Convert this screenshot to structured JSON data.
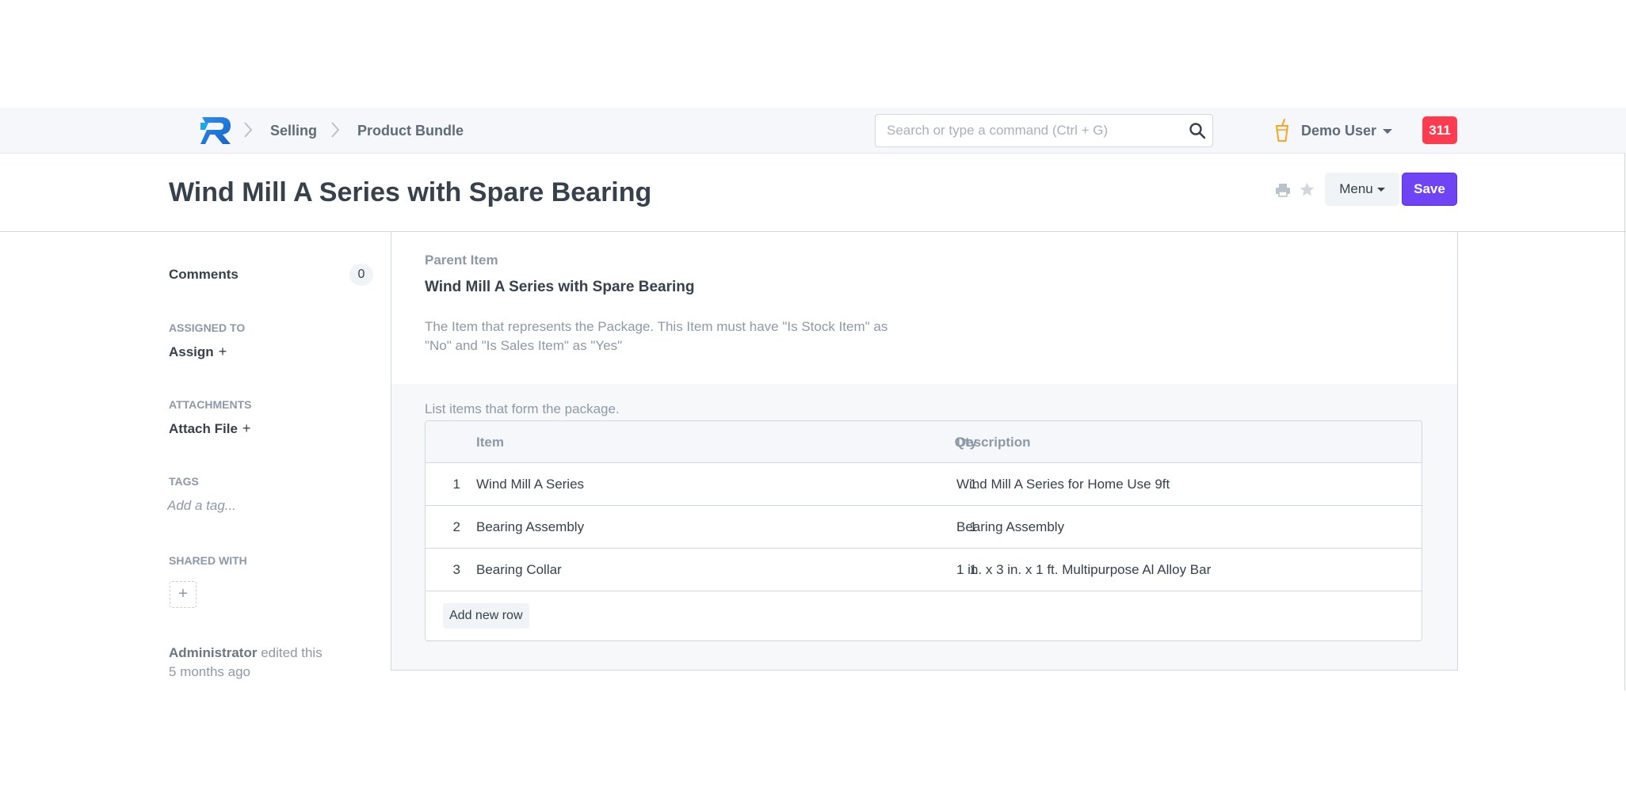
{
  "navbar": {
    "breadcrumbs": [
      "Selling",
      "Product Bundle"
    ],
    "search_placeholder": "Search or type a command (Ctrl + G)",
    "user_name": "Demo User",
    "notification_count": "311",
    "brand_color": "#2490ef",
    "badge_color": "#ff3b4f"
  },
  "page": {
    "title": "Wind Mill A Series with Spare Bearing",
    "menu_label": "Menu",
    "save_label": "Save",
    "primary_color": "#6f44f5"
  },
  "sidebar": {
    "comments_label": "Comments",
    "comments_count": "0",
    "assigned_heading": "ASSIGNED TO",
    "assign_label": "Assign",
    "attachments_heading": "ATTACHMENTS",
    "attach_label": "Attach File",
    "tags_heading": "TAGS",
    "tag_placeholder": "Add a tag...",
    "shared_heading": "SHARED WITH",
    "edited_by": "Administrator",
    "edited_text": "edited this",
    "edited_when": "5 months ago"
  },
  "form": {
    "parent_label": "Parent Item",
    "parent_value": "Wind Mill A Series with Spare Bearing",
    "parent_description": "The Item that represents the Package. This Item must have \"Is Stock Item\" as \"No\" and \"Is Sales Item\" as \"Yes\"",
    "table_caption": "List items that form the package.",
    "columns": {
      "item": "Item",
      "qty": "Qty",
      "description": "Description"
    },
    "rows": [
      {
        "idx": "1",
        "item": "Wind Mill A Series",
        "qty": "1",
        "description": "Wind Mill A Series for Home Use 9ft"
      },
      {
        "idx": "2",
        "item": "Bearing Assembly",
        "qty": "1",
        "description": "Bearing Assembly"
      },
      {
        "idx": "3",
        "item": "Bearing Collar",
        "qty": "1",
        "description": "1 in. x 3 in. x 1 ft. Multipurpose Al Alloy Bar"
      }
    ],
    "add_row_label": "Add new row"
  }
}
